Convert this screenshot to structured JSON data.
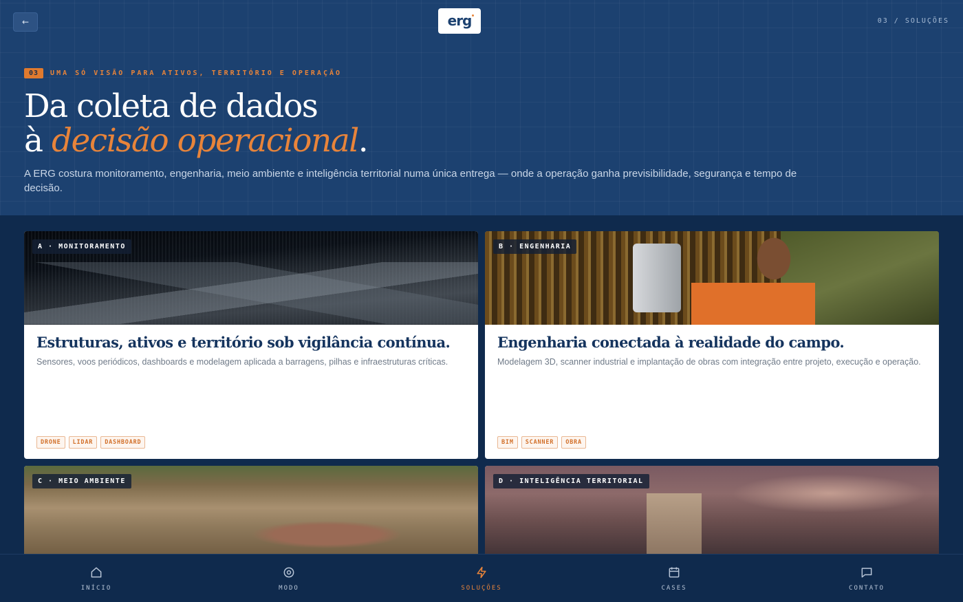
{
  "topbar": {
    "back_label": "←",
    "logo_text": "erg",
    "section_tag": "03 / SOLUÇÕES"
  },
  "hero": {
    "eyebrow_number": "03",
    "eyebrow_text": "UMA SÓ VISÃO PARA ATIVOS, TERRITÓRIO E OPERAÇÃO",
    "headline_line1": "Da coleta de dados",
    "headline_line2_prefix": "à ",
    "headline_line2_accent": "decisão operacional",
    "headline_line2_suffix": ".",
    "intro": "A ERG costura monitoramento, engenharia, meio ambiente e inteligência territorial numa única entrega — onde a operação ganha previsibilidade, segurança e tempo de decisão."
  },
  "cards": [
    {
      "label": "A · MONITORAMENTO",
      "title": "Estruturas, ativos e território sob vigilância contínua.",
      "description": "Sensores, voos periódicos, dashboards e modelagem aplicada a barragens, pilhas e infraestruturas críticas.",
      "tags": [
        "DRONE",
        "LIDAR",
        "DASHBOARD"
      ]
    },
    {
      "label": "B · ENGENHARIA",
      "title": "Engenharia conectada à realidade do campo.",
      "description": "Modelagem 3D, scanner industrial e implantação de obras com integração entre projeto, execução e operação.",
      "tags": [
        "BIM",
        "SCANNER",
        "OBRA"
      ]
    },
    {
      "label": "C · MEIO AMBIENTE"
    },
    {
      "label": "D · INTELIGÊNCIA TERRITORIAL"
    }
  ],
  "nav": {
    "items": [
      {
        "label": "INÍCIO",
        "icon": "home-icon"
      },
      {
        "label": "MODO",
        "icon": "target-icon"
      },
      {
        "label": "SOLUÇÕES",
        "icon": "bolt-icon",
        "active": true
      },
      {
        "label": "CASES",
        "icon": "calendar-icon"
      },
      {
        "label": "CONTATO",
        "icon": "chat-icon"
      }
    ]
  },
  "colors": {
    "hero_bg": "#1c4170",
    "page_bg": "#0f2a4d",
    "accent": "#e8843a",
    "card_title": "#15345e"
  }
}
